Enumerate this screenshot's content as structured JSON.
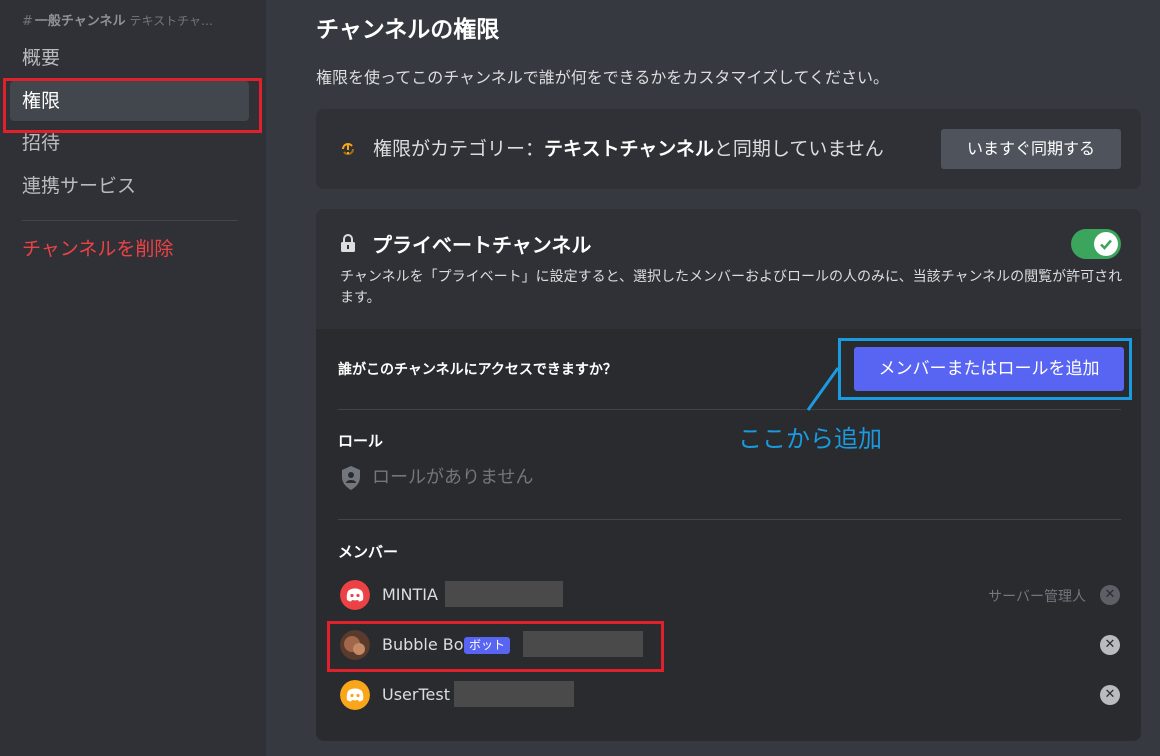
{
  "sidebar": {
    "header_hash": "#",
    "header_channel": "一般チャンネル",
    "header_category": "テキストチャ…",
    "items": [
      {
        "label": "概要"
      },
      {
        "label": "権限"
      },
      {
        "label": "招待"
      },
      {
        "label": "連携サービス"
      }
    ],
    "delete_label": "チャンネルを削除"
  },
  "main": {
    "title": "チャンネルの権限",
    "description": "権限を使ってこのチャンネルで誰が何をできるかをカスタマイズしてください。",
    "sync": {
      "text_before": "権限がカテゴリー：",
      "category": "テキストチャンネル",
      "text_after": "と同期していません",
      "button_label": "いますぐ同期する"
    },
    "private": {
      "title": "プライベートチャンネル",
      "description": "チャンネルを「プライベート」に設定すると、選択したメンバーおよびロールの人のみに、当該チャンネルの閲覧が許可されます。",
      "toggle_on": true,
      "who_label": "誰がこのチャンネルにアクセスできますか？",
      "add_button_label": "メンバーまたはロールを追加",
      "roles_label": "ロール",
      "no_roles": "ロールがありません",
      "members_label": "メンバー",
      "members": [
        {
          "name": "MINTIA",
          "role": "サーバー管理人",
          "avatar_color": "#ed4245"
        },
        {
          "name": "Bubble Bot",
          "tag": "ボット",
          "avatar_color": "#8a5a44"
        },
        {
          "name": "UserTest",
          "avatar_color": "#faa61a"
        }
      ]
    }
  },
  "annotation": {
    "text": "ここから追加"
  },
  "colors": {
    "accent": "#5865f2",
    "danger": "#ed4245",
    "toggle_on": "#3ba55d",
    "annotation_blue": "#1a9be0",
    "highlight_red": "#e0202a"
  }
}
